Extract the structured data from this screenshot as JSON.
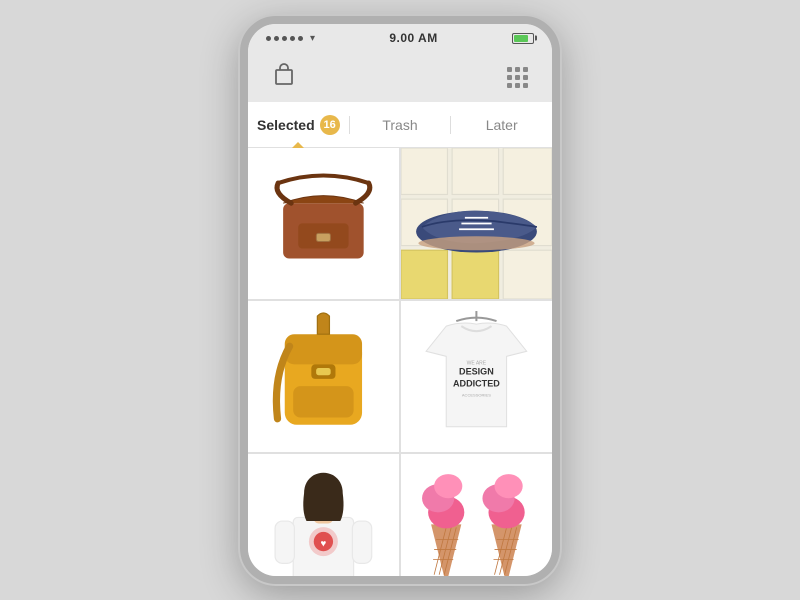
{
  "status": {
    "time": "9.00 AM",
    "signal_dots": 5,
    "battery_pct": 80
  },
  "tabs": [
    {
      "id": "selected",
      "label": "Selected",
      "badge": 16,
      "active": true
    },
    {
      "id": "trash",
      "label": "Trash",
      "active": false
    },
    {
      "id": "later",
      "label": "Later",
      "active": false
    }
  ],
  "grid_items": [
    {
      "id": "item-1",
      "type": "brown-bag",
      "alt": "Brown leather messenger bag"
    },
    {
      "id": "item-2",
      "type": "blue-shoe",
      "alt": "Blue suede oxford shoe"
    },
    {
      "id": "item-3",
      "type": "yellow-backpack",
      "alt": "Yellow backpack"
    },
    {
      "id": "item-4",
      "type": "white-shirt",
      "alt": "Design Addicted t-shirt"
    },
    {
      "id": "item-5",
      "type": "woman-shirt",
      "alt": "Woman in white shirt"
    },
    {
      "id": "item-6",
      "type": "ice-cream",
      "alt": "Pink ice cream cones"
    }
  ],
  "nav": {
    "shop_icon": "🛍",
    "grid_icon": "grid"
  }
}
